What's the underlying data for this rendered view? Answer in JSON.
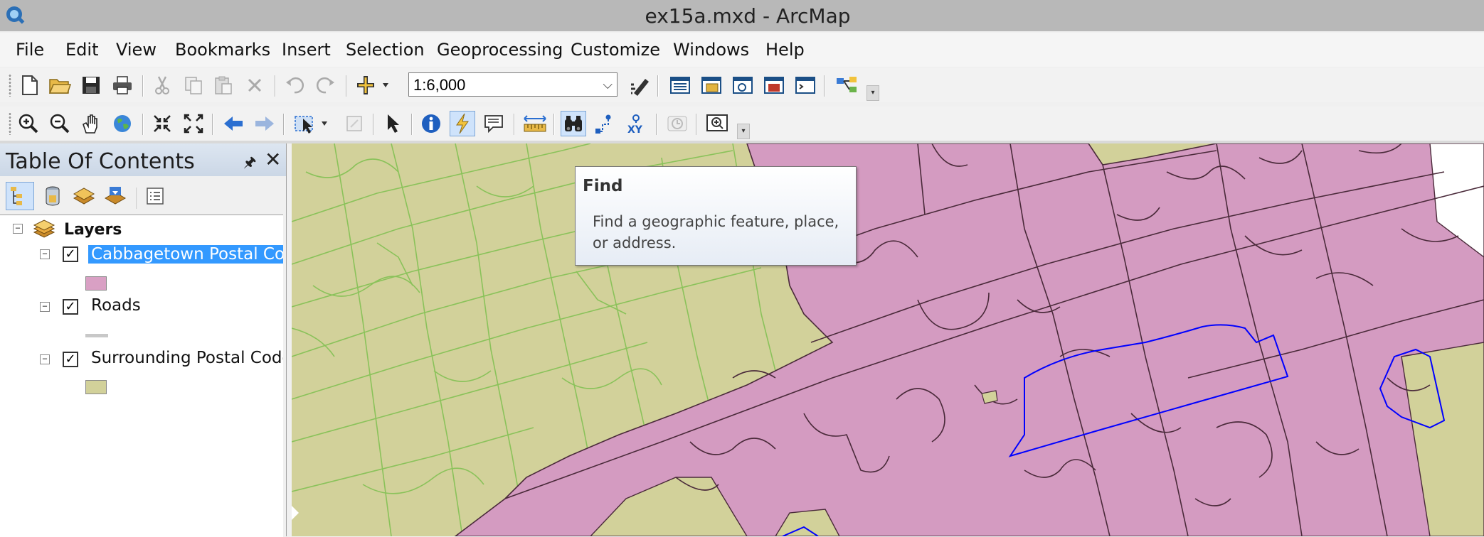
{
  "window": {
    "title": "ex15a.mxd - ArcMap"
  },
  "menu": {
    "items": [
      "File",
      "Edit",
      "View",
      "Bookmarks",
      "Insert",
      "Selection",
      "Geoprocessing",
      "Customize",
      "Windows",
      "Help"
    ]
  },
  "toolbar": {
    "scale_value": "1:6,000"
  },
  "toc": {
    "title": "Table Of Contents",
    "root_label": "Layers",
    "layers": [
      {
        "label": "Cabbagetown Postal Cod",
        "checked": true,
        "selected": true,
        "swatch_color": "#d9a0c4"
      },
      {
        "label": "Roads",
        "checked": true,
        "selected": false,
        "swatch_color": "#c8c8c8"
      },
      {
        "label": "Surrounding Postal Code",
        "checked": true,
        "selected": false,
        "swatch_color": "#d2d19a"
      }
    ]
  },
  "tooltip": {
    "title": "Find",
    "description": "Find a geographic feature, place, or address."
  },
  "colors": {
    "cabbagetown_fill": "#d49bc1",
    "surrounding_fill": "#d2d19a",
    "surrounding_lines": "#8ac25a",
    "selection_outline": "#0000ff",
    "selected_label_bg": "#3399ff"
  }
}
